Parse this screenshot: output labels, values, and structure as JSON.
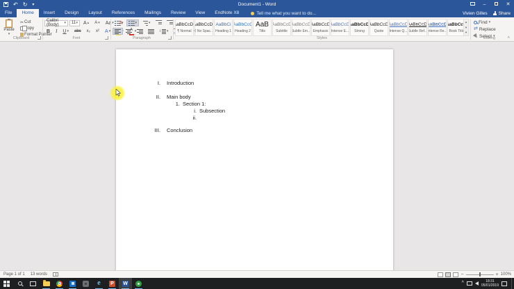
{
  "titlebar": {
    "title": "Document1 - Word",
    "user": "Vivien Gilles",
    "share": "Share"
  },
  "tabs": {
    "items": [
      "File",
      "Home",
      "Insert",
      "Design",
      "Layout",
      "References",
      "Mailings",
      "Review",
      "View",
      "EndNote X8"
    ],
    "active": "Home",
    "tellme": "Tell me what you want to do..."
  },
  "ribbon": {
    "clipboard": {
      "label": "Clipboard",
      "paste": "Paste",
      "cut": "Cut",
      "copy": "Copy",
      "format_painter": "Format Painter"
    },
    "font": {
      "label": "Font",
      "family": "Calibri (Body)",
      "size": "11",
      "buttons": {
        "bold": "B",
        "italic": "I",
        "underline": "U",
        "strike": "abc",
        "sub": "x₂",
        "sup": "x²",
        "grow": "A",
        "shrink": "A",
        "case": "Aa",
        "clear": "A",
        "effects": "A",
        "highlight": "ab",
        "color": "A"
      }
    },
    "paragraph": {
      "label": "Paragraph",
      "sort": "A↓",
      "pilcrow": "¶",
      "spacing": "↕"
    },
    "styles": {
      "label": "Styles",
      "items": [
        {
          "preview": "AaBbCcDc",
          "label": "¶ Normal"
        },
        {
          "preview": "AaBbCcDc",
          "label": "¶ No Spac..."
        },
        {
          "preview": "AaBbCi",
          "label": "Heading 1"
        },
        {
          "preview": "AaBbCcC",
          "label": "Heading 2"
        },
        {
          "preview": "AaB",
          "label": "Title"
        },
        {
          "preview": "AaBbCcD",
          "label": "Subtitle"
        },
        {
          "preview": "AaBbCcDi",
          "label": "Subtle Em..."
        },
        {
          "preview": "AaBbCcDi",
          "label": "Emphasis"
        },
        {
          "preview": "AaBbCcDi",
          "label": "Intense E..."
        },
        {
          "preview": "AaBbCcDi",
          "label": "Strong"
        },
        {
          "preview": "AaBbCcDi",
          "label": "Quote"
        },
        {
          "preview": "AaBbCcDi",
          "label": "Intense Q..."
        },
        {
          "preview": "AaBbCcDi",
          "label": "Subtle Ref..."
        },
        {
          "preview": "AaBbCcDi",
          "label": "Intense Re..."
        },
        {
          "preview": "AaBbCcDi",
          "label": "Book Title"
        }
      ]
    },
    "editing": {
      "label": "Editing",
      "find": "Find",
      "replace": "Replace",
      "select": "Select"
    }
  },
  "document": {
    "lines": [
      {
        "marker": "I.",
        "text": "Introduction"
      },
      {
        "marker": "II.",
        "text": "Main body"
      },
      {
        "marker": "1.",
        "text": "Section 1:"
      },
      {
        "marker": "i.",
        "text": "Subsection"
      },
      {
        "marker": "ii.",
        "text": ""
      },
      {
        "marker": "III.",
        "text": "Conclusion"
      }
    ]
  },
  "statusbar": {
    "page": "Page 1 of 1",
    "words": "13 words",
    "zoom": "100%"
  },
  "taskbar": {
    "time": "18:31",
    "date": "05/01/2019",
    "apps": {
      "word": "W",
      "powerpoint": "P",
      "ie": "e"
    }
  },
  "icons": {
    "dropdown": "▾",
    "undo": "↶",
    "redo": "↻",
    "cut": "✂",
    "up": "▴",
    "down": "▾",
    "replace": "⇄",
    "collapse": "˄",
    "tray_chevron": "^"
  },
  "colors": {
    "accent": "#2b579a",
    "heading_blue": "#2e74b5",
    "taskbar_underline": "#76b9ed",
    "cursor_highlight": "#faf246"
  }
}
